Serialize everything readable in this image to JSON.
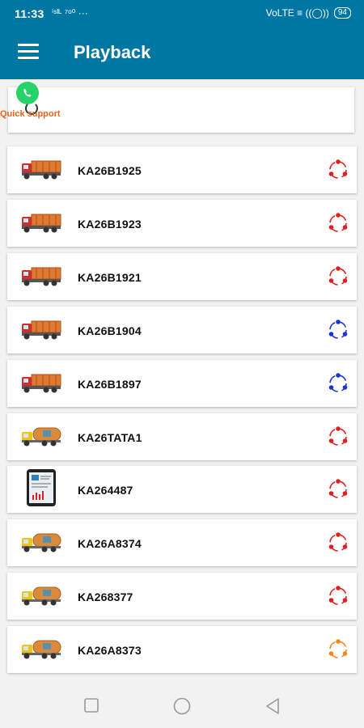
{
  "status_bar": {
    "time": "11:33",
    "left_icons_text": "ⁱˢᴵᴸ ⁷ᵒ⁰ ···",
    "right_icons_text": "VoLTE ≡ ((◯))",
    "battery": "94"
  },
  "app_bar": {
    "title": "Playback"
  },
  "support": {
    "label": "Quick support"
  },
  "vehicles": [
    {
      "number": "KA26B1925",
      "icon": "truck-icon",
      "status_color": "#e02020"
    },
    {
      "number": "KA26B1923",
      "icon": "truck-icon",
      "status_color": "#e02020"
    },
    {
      "number": "KA26B1921",
      "icon": "truck-icon",
      "status_color": "#e02020"
    },
    {
      "number": "KA26B1904",
      "icon": "truck-icon",
      "status_color": "#1a35d6"
    },
    {
      "number": "KA26B1897",
      "icon": "truck-icon",
      "status_color": "#1a35d6"
    },
    {
      "number": "KA26TATA1",
      "icon": "tanker-icon",
      "status_color": "#e02020"
    },
    {
      "number": "KA264487",
      "icon": "tablet-icon",
      "status_color": "#e02020"
    },
    {
      "number": "KA26A8374",
      "icon": "tanker-icon",
      "status_color": "#e02020"
    },
    {
      "number": "KA268377",
      "icon": "tanker-icon",
      "status_color": "#e02020"
    },
    {
      "number": "KA26A8373",
      "icon": "tanker-icon",
      "status_color": "#f08a1c"
    }
  ],
  "nav_bar": {
    "icons": [
      "recent-apps-icon",
      "home-icon",
      "back-icon"
    ]
  },
  "colors": {
    "primary": "#0077a3",
    "support_label": "#e8641b"
  }
}
